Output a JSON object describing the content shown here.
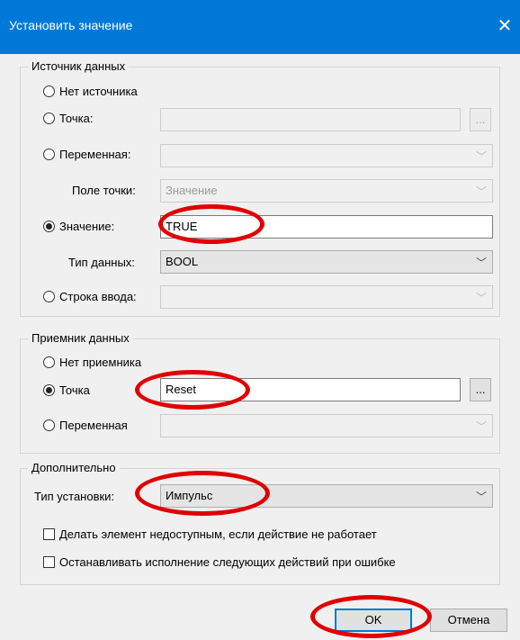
{
  "window": {
    "title": "Установить значение",
    "close_glyph": "✕"
  },
  "source_group": {
    "legend": "Источник данных",
    "no_source": "Нет источника",
    "point_label": "Точка:",
    "point_browse": "...",
    "variable_label": "Переменная:",
    "point_field_label": "Поле точки:",
    "point_field_value": "Значение",
    "value_label": "Значение:",
    "value_value": "TRUE",
    "datatype_label": "Тип данных:",
    "datatype_value": "BOOL",
    "input_string_label": "Строка ввода:",
    "selected": "value"
  },
  "target_group": {
    "legend": "Приемник данных",
    "no_target": "Нет приемника",
    "point_label": "Точка",
    "point_value": "Reset",
    "point_browse": "...",
    "variable_label": "Переменная",
    "selected": "point"
  },
  "extra_group": {
    "legend": "Дополнительно",
    "set_type_label": "Тип установки:",
    "set_type_value": "Импульс",
    "disable_checkbox": "Делать элемент недоступным, если действие не работает",
    "stop_checkbox": "Останавливать исполнение следующих действий при ошибке"
  },
  "buttons": {
    "ok": "OK",
    "cancel": "Отмена"
  },
  "colors": {
    "titlebar": "#0078d7",
    "dialog_bg": "#f0f0f0",
    "highlight": "#e00000"
  },
  "icons": {
    "dropdown": "chevron-down-icon",
    "close": "close-icon"
  }
}
